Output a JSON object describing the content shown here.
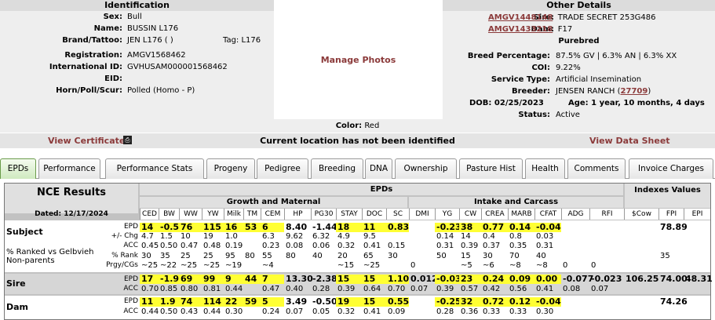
{
  "identification": {
    "title": "Identification",
    "rows": [
      {
        "label": "Sex:",
        "value": "Bull"
      },
      {
        "label": "Name:",
        "value": "BUSSIN L176"
      },
      {
        "label": "Brand/Tattoo:",
        "value": "JEN L176 ( )",
        "extra": "Tag: L176"
      },
      {
        "label": "Registration:",
        "value": "AMGV1568462"
      },
      {
        "label": "International ID:",
        "value": "GVHUSAM000001568462"
      },
      {
        "label": "EID:",
        "value": ""
      },
      {
        "label": "Horn/Poll/Scur:",
        "value": "Polled (Homo - P)"
      }
    ]
  },
  "photo": {
    "label": "Manage Photos"
  },
  "other": {
    "title": "Other Details",
    "sire_label": "Sire:",
    "sire_id": "AMGV1448148",
    "sire_name": "TRADE SECRET 253G486",
    "dam_label": "Dam:",
    "dam_id": "AMGV1433218",
    "dam_name": "F17",
    "purebred": "Purebred",
    "breed_pct_label": "Breed Percentage:",
    "breed_pct": "87.5% GV | 6.3% AN | 6.3% XX",
    "coi_label": "COI:",
    "coi": "9.22%",
    "service_label": "Service Type:",
    "service": "Artificial Insemination",
    "breeder_label": "Breeder:",
    "breeder": "JENSEN RANCH (",
    "breeder_id": "27709",
    "breeder_close": ")",
    "dob": "DOB: 02/25/2023",
    "age": "Age: 1 year, 10 months, 4 days",
    "status_label": "Status:",
    "status": "Active"
  },
  "color": {
    "label": "Color:",
    "value": "Red"
  },
  "cert_bar": {
    "view_certificate": "View Certificate",
    "print_icon": "printer-icon",
    "location": "Current location has not been identified",
    "view_data_sheet": "View Data Sheet"
  },
  "tabs": [
    "EPDs",
    "Performance",
    "Performance Stats",
    "Progeny",
    "Pedigree",
    "Breeding",
    "DNA",
    "Ownership",
    "Pasture Hist",
    "Health",
    "Comments",
    "Invoice Charges"
  ],
  "epd_table": {
    "title": "NCE Results",
    "dated": "Dated: 12/17/2024",
    "epds_header": "EPDs",
    "growth_header": "Growth and Maternal",
    "intake_header": "Intake and Carcass",
    "indexes_header": "Indexes Values",
    "traits_growth": [
      "CED",
      "BW",
      "WW",
      "YW",
      "Milk",
      "TM",
      "CEM",
      "HP",
      "PG30",
      "STAY",
      "DOC",
      "SC"
    ],
    "traits_intake": [
      "DMI",
      "YG",
      "CW",
      "CREA",
      "MARB",
      "CFAT",
      "ADG",
      "RFI"
    ],
    "traits_index": [
      "$Cow",
      "FPI",
      "EPI"
    ],
    "subject": {
      "label": "Subject",
      "sub_label": "% Ranked vs Gelbvieh Non-parents",
      "row_labels": [
        "EPD",
        "+/- Chg",
        "ACC",
        "% Rank",
        "Prgy/CGs"
      ],
      "epd": [
        "14",
        "-0.5",
        "76",
        "115",
        "16",
        "53",
        "6",
        "8.40",
        "-1.44",
        "18",
        "11",
        "0.83",
        "",
        "-0.23",
        "38",
        "0.77",
        "0.14",
        "-0.04",
        "",
        "",
        "",
        "78.89",
        ""
      ],
      "chg": [
        "4.7",
        "1.5",
        "10",
        "19",
        "1.0",
        "",
        "6.3",
        "9.62",
        "6.32",
        "4.9",
        "9.5",
        "",
        "",
        "0.14",
        "14",
        "0.4",
        "0.8",
        "0.03",
        "",
        "",
        "",
        "",
        ""
      ],
      "acc": [
        "0.45",
        "0.50",
        "0.47",
        "0.48",
        "0.19",
        "",
        "0.23",
        "0.08",
        "0.06",
        "0.32",
        "0.41",
        "0.15",
        "",
        "0.31",
        "0.39",
        "0.37",
        "0.35",
        "0.31",
        "",
        "",
        "",
        "",
        ""
      ],
      "rank": [
        "30",
        "35",
        "25",
        "25",
        "95",
        "80",
        "55",
        "80",
        "40",
        "20",
        "65",
        "30",
        "",
        "50",
        "15",
        "30",
        "70",
        "40",
        "",
        "",
        "",
        "35",
        ""
      ],
      "prgy": [
        "~25",
        "~22",
        "~25",
        "~25",
        "~19",
        "",
        "~4",
        "",
        "",
        "~15",
        "~25",
        "",
        "0",
        "",
        "~5",
        "~6",
        "~8",
        "~8",
        "0",
        "0",
        "",
        "",
        ""
      ]
    },
    "sire": {
      "label": "Sire",
      "epd": [
        "17",
        "-1.9",
        "69",
        "99",
        "9",
        "44",
        "7",
        "13.30",
        "-2.38",
        "15",
        "15",
        "1.10",
        "0.012",
        "-0.03",
        "23",
        "0.24",
        "0.09",
        "0.00",
        "-0.077",
        "-0.023",
        "106.25",
        "74.00",
        "48.31"
      ],
      "acc": [
        "0.70",
        "0.85",
        "0.80",
        "0.81",
        "0.44",
        "",
        "0.47",
        "0.40",
        "0.28",
        "0.39",
        "0.64",
        "0.70",
        "0.07",
        "0.39",
        "0.57",
        "0.42",
        "0.56",
        "0.41",
        "0.08",
        "0.07",
        "",
        "",
        ""
      ]
    },
    "dam": {
      "label": "Dam",
      "epd": [
        "11",
        "1.9",
        "74",
        "114",
        "22",
        "59",
        "5",
        "3.49",
        "-0.50",
        "19",
        "15",
        "0.55",
        "",
        "-0.25",
        "32",
        "0.72",
        "0.12",
        "-0.04",
        "",
        "",
        "",
        "74.26",
        ""
      ],
      "acc": [
        "0.44",
        "0.50",
        "0.43",
        "0.44",
        "0.30",
        "",
        "0.24",
        "0.07",
        "0.05",
        "0.32",
        "0.41",
        "0.09",
        "",
        "0.28",
        "0.36",
        "0.33",
        "0.33",
        "0.30",
        "",
        "",
        "",
        "",
        ""
      ]
    }
  }
}
